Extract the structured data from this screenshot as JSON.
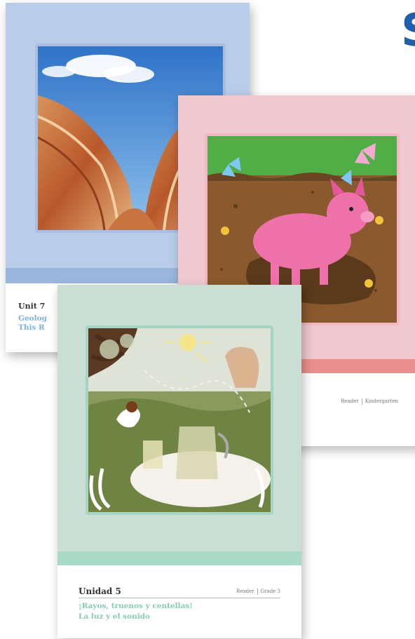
{
  "heading": {
    "visible_letter": "S"
  },
  "colors": {
    "heading": "#1f5fae",
    "geology_title": "#7fb3df",
    "spanish_title": "#86cbb4"
  },
  "books": {
    "geology": {
      "unit_label": "Unit 7",
      "title_line1": "Geolog",
      "title_line2": "This R"
    },
    "pig": {
      "meta_type": "Reader",
      "meta_grade": "Kindergarten"
    },
    "sound": {
      "unit_label": "Unidad 5",
      "meta_type": "Reader",
      "meta_grade": "Grade 3",
      "title_line1": "¡Rayos, truenos y centellas!",
      "title_line2": "La luz y el sonido"
    }
  }
}
